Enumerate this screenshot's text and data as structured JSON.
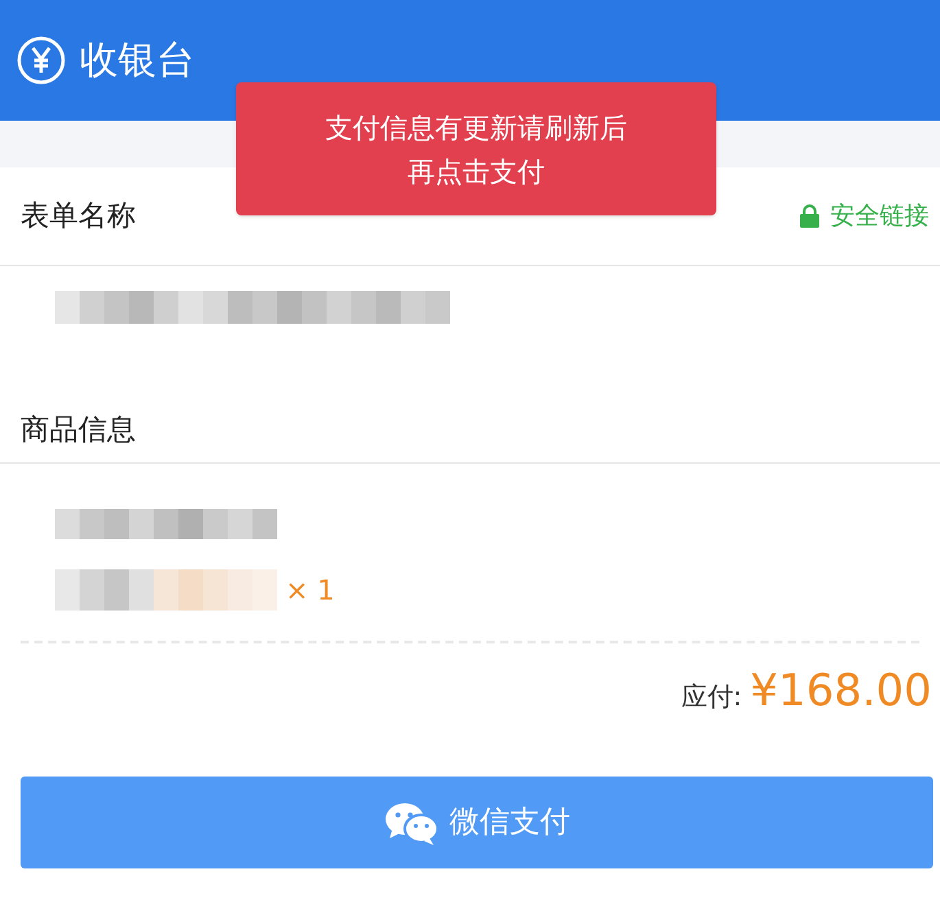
{
  "header": {
    "title": "收银台"
  },
  "toast": {
    "lines": [
      "支付信息有更新请刷新后",
      "再点击支付"
    ]
  },
  "form": {
    "label": "表单名称",
    "secure": "安全链接"
  },
  "goods": {
    "label": "商品信息",
    "quantity": "× 1"
  },
  "total": {
    "label": "应付:",
    "amount": "¥168.00"
  },
  "pay_button": {
    "label": "微信支付"
  }
}
